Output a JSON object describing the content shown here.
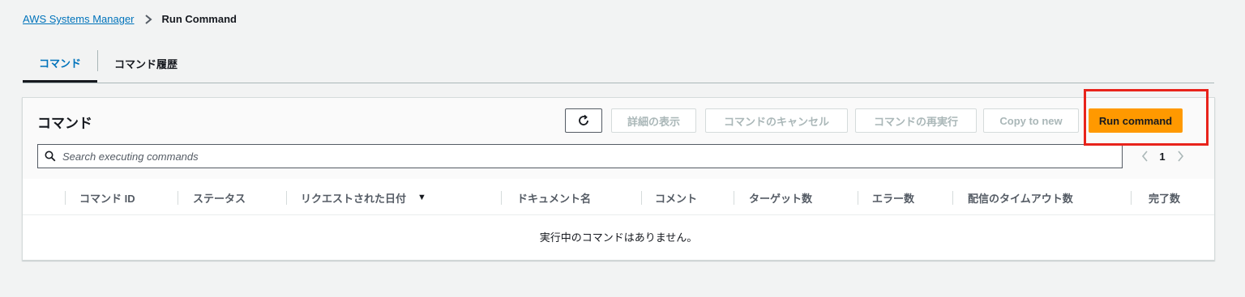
{
  "breadcrumb": {
    "parent": "AWS Systems Manager",
    "current": "Run Command"
  },
  "tabs": [
    {
      "label": "コマンド"
    },
    {
      "label": "コマンド履歴"
    }
  ],
  "panel": {
    "title": "コマンド",
    "buttons": {
      "details": "詳細の表示",
      "cancel": "コマンドのキャンセル",
      "rerun": "コマンドの再実行",
      "copy": "Copy to new",
      "run": "Run command"
    },
    "search_placeholder": "Search executing commands",
    "page": "1",
    "columns": [
      "コマンド ID",
      "ステータス",
      "リクエストされた日付",
      "ドキュメント名",
      "コメント",
      "ターゲット数",
      "エラー数",
      "配信のタイムアウト数",
      "完了数"
    ],
    "sort_indicator": "▼",
    "empty_message": "実行中のコマンドはありません。"
  },
  "colors": {
    "primary": "#ff9900",
    "highlight": "#e8231b",
    "link": "#0073bb"
  },
  "icons": [
    "chevron-right-icon",
    "refresh-icon",
    "search-icon",
    "chevron-left-icon",
    "sort-desc-icon"
  ]
}
